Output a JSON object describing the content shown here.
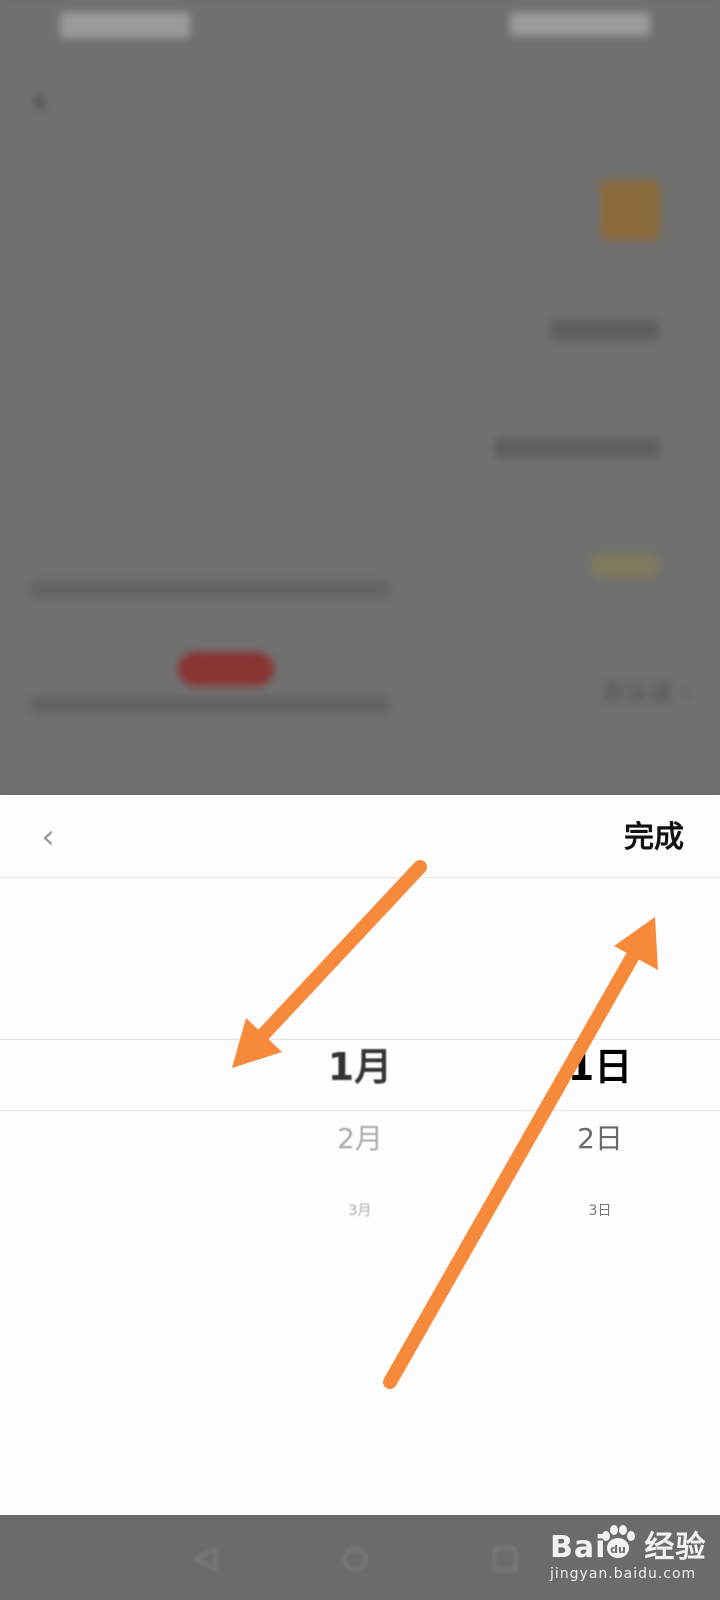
{
  "background_page": {
    "title": "",
    "rows": [
      {
        "label": "",
        "value": ""
      },
      {
        "label": "",
        "value": ""
      },
      {
        "label": "",
        "value": ""
      },
      {
        "label": "",
        "value": ""
      },
      {
        "label": "",
        "action": "去认证"
      }
    ]
  },
  "picker": {
    "done_label": "完成",
    "year": [
      "",
      "",
      "",
      "",
      ""
    ],
    "month": [
      "",
      "",
      "1月",
      "2月",
      "3月"
    ],
    "day": [
      "",
      "",
      "1日",
      "2日",
      "3日"
    ]
  },
  "watermark": {
    "brand_left": "Bai",
    "brand_right": "经验",
    "url": "jingyan.baidu.com"
  },
  "colors": {
    "arrow": "#F7893B",
    "dim_overlay": "#707070",
    "sheet_bg": "#FDFDFD"
  },
  "icons": {
    "back": "chevron-left-icon",
    "verify_chevron": "chevron-right-icon",
    "nav_back": "back-icon",
    "nav_home": "home-icon",
    "nav_recent": "recent-apps-icon"
  }
}
